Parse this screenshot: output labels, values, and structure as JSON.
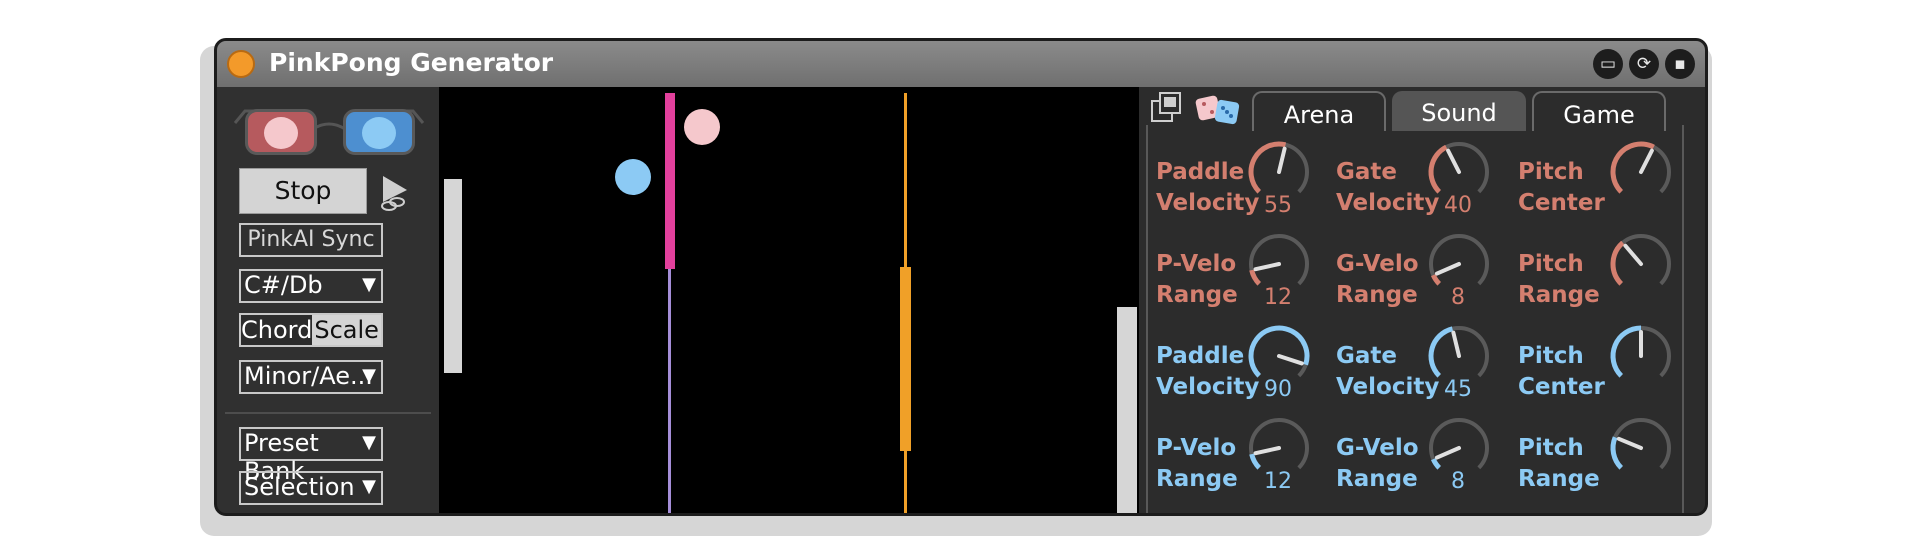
{
  "app": {
    "title": "PinkPong Generator"
  },
  "colors": {
    "pink": "#f5c8cc",
    "blue": "#8ccaf4",
    "magenta": "#e2409c",
    "orange": "#f0a028",
    "coral": "#d47f6f",
    "knobBlue": "#8ccaf4"
  },
  "titlebar": {
    "pin_icon": "pin-icon",
    "sync_icon": "sync-icon",
    "save_icon": "save-icon"
  },
  "controls": {
    "stop_label": "Stop",
    "sync_label": "PinkAI Sync",
    "key_value": "C#/Db",
    "chord_label": "Chord",
    "scale_label": "Scale",
    "mode_value": "Minor/Ae...",
    "preset_bank_value": "Preset Bank",
    "selection_value": "Selection"
  },
  "tabs": {
    "arena": "Arena",
    "sound": "Sound",
    "game": "Game",
    "active": "Arena"
  },
  "knobs": [
    {
      "label": "Paddle\nVelocity",
      "value": "55",
      "percent": 55,
      "color": "coral"
    },
    {
      "label": "Gate\nVelocity",
      "value": "40",
      "percent": 40,
      "color": "coral"
    },
    {
      "label": "Pitch\nCenter",
      "value": "",
      "percent": 60,
      "color": "coral"
    },
    {
      "label": "P-Velo\nRange",
      "value": "12",
      "percent": 12,
      "color": "coral"
    },
    {
      "label": "G-Velo\nRange",
      "value": "8",
      "percent": 8,
      "color": "coral"
    },
    {
      "label": "Pitch\nRange",
      "value": "",
      "percent": 35,
      "color": "coral"
    },
    {
      "label": "Paddle\nVelocity",
      "value": "90",
      "percent": 90,
      "color": "blue"
    },
    {
      "label": "Gate\nVelocity",
      "value": "45",
      "percent": 45,
      "color": "blue"
    },
    {
      "label": "Pitch\nCenter",
      "value": "",
      "percent": 50,
      "color": "blue"
    },
    {
      "label": "P-Velo\nRange",
      "value": "12",
      "percent": 12,
      "color": "blue"
    },
    {
      "label": "G-Velo\nRange",
      "value": "8",
      "percent": 8,
      "color": "blue"
    },
    {
      "label": "Pitch\nRange",
      "value": "",
      "percent": 25,
      "color": "blue"
    }
  ]
}
